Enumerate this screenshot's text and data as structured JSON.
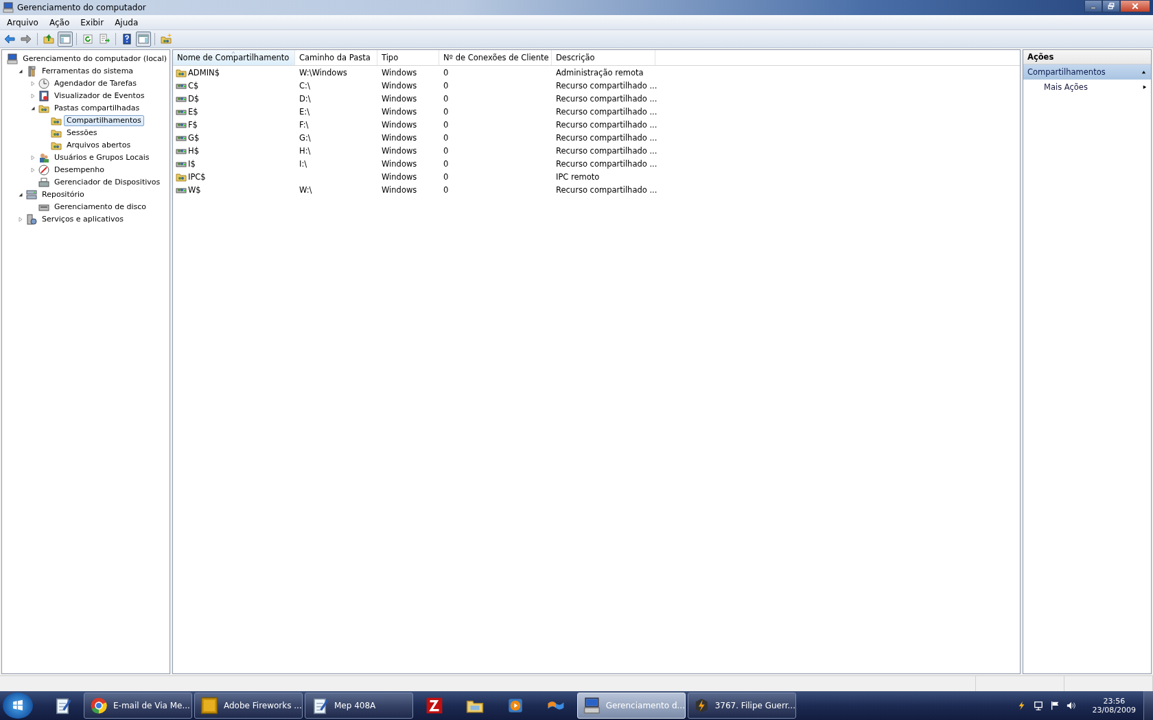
{
  "window": {
    "title": "Gerenciamento do computador"
  },
  "menu": [
    {
      "label": "Arquivo"
    },
    {
      "label": "Ação"
    },
    {
      "label": "Exibir"
    },
    {
      "label": "Ajuda"
    }
  ],
  "toolbar": [
    {
      "buttons": [
        {
          "kind": "back",
          "pressed": false
        },
        {
          "kind": "forward",
          "pressed": false
        }
      ]
    },
    {
      "buttons": [
        {
          "kind": "up",
          "pressed": false
        },
        {
          "kind": "tree",
          "pressed": true
        }
      ]
    },
    {
      "buttons": [
        {
          "kind": "refresh",
          "pressed": false
        },
        {
          "kind": "export",
          "pressed": false
        }
      ]
    },
    {
      "buttons": [
        {
          "kind": "help",
          "pressed": false
        },
        {
          "kind": "pane",
          "pressed": true
        }
      ]
    },
    {
      "buttons": [
        {
          "kind": "newshare",
          "pressed": false
        }
      ]
    }
  ],
  "tree": [
    {
      "label": "Gerenciamento do computador (local)",
      "kind": "computer",
      "selected": false,
      "children": [
        {
          "label": "Ferramentas do sistema",
          "kind": "tools",
          "expanded": true,
          "selected": false,
          "children": [
            {
              "label": "Agendador de Tarefas",
              "kind": "clock",
              "expanded": false,
              "selected": false
            },
            {
              "label": "Visualizador de Eventos",
              "kind": "event",
              "expanded": false,
              "selected": false
            },
            {
              "label": "Pastas compartilhadas",
              "kind": "share",
              "expanded": true,
              "selected": false,
              "children": [
                {
                  "label": "Compartilhamentos",
                  "kind": "share",
                  "selected": true
                },
                {
                  "label": "Sessões",
                  "kind": "share",
                  "selected": false
                },
                {
                  "label": "Arquivos abertos",
                  "kind": "share",
                  "selected": false
                }
              ]
            },
            {
              "label": "Usuários e Grupos Locais",
              "kind": "users",
              "expanded": false,
              "selected": false
            },
            {
              "label": "Desempenho",
              "kind": "perf",
              "expanded": false,
              "selected": false
            },
            {
              "label": "Gerenciador de Dispositivos",
              "kind": "device",
              "selected": false
            }
          ]
        },
        {
          "label": "Repositório",
          "kind": "storage",
          "expanded": true,
          "selected": false,
          "children": [
            {
              "label": "Gerenciamento de disco",
              "kind": "disk",
              "selected": false
            }
          ]
        },
        {
          "label": "Serviços e aplicativos",
          "kind": "services",
          "expanded": false,
          "selected": false
        }
      ]
    }
  ],
  "table": {
    "columns": [
      {
        "label": "Nome de Compartilhamento",
        "sorted": true
      },
      {
        "label": "Caminho da Pasta",
        "sorted": false
      },
      {
        "label": "Tipo",
        "sorted": false
      },
      {
        "label": "Nº de Conexões de Cliente",
        "sorted": false
      },
      {
        "label": "Descrição",
        "sorted": false
      }
    ],
    "rows": [
      {
        "kind": "folder",
        "cells": [
          "ADMIN$",
          "W:\\Windows",
          "Windows",
          "0",
          "Administração remota"
        ]
      },
      {
        "kind": "drive",
        "cells": [
          "C$",
          "C:\\",
          "Windows",
          "0",
          "Recurso compartilhado ..."
        ]
      },
      {
        "kind": "drive",
        "cells": [
          "D$",
          "D:\\",
          "Windows",
          "0",
          "Recurso compartilhado ..."
        ]
      },
      {
        "kind": "drive",
        "cells": [
          "E$",
          "E:\\",
          "Windows",
          "0",
          "Recurso compartilhado ..."
        ]
      },
      {
        "kind": "drive",
        "cells": [
          "F$",
          "F:\\",
          "Windows",
          "0",
          "Recurso compartilhado ..."
        ]
      },
      {
        "kind": "drive",
        "cells": [
          "G$",
          "G:\\",
          "Windows",
          "0",
          "Recurso compartilhado ..."
        ]
      },
      {
        "kind": "drive",
        "cells": [
          "H$",
          "H:\\",
          "Windows",
          "0",
          "Recurso compartilhado ..."
        ]
      },
      {
        "kind": "drive",
        "cells": [
          "I$",
          "I:\\",
          "Windows",
          "0",
          "Recurso compartilhado ..."
        ]
      },
      {
        "kind": "folder",
        "cells": [
          "IPC$",
          "",
          "Windows",
          "0",
          "IPC remoto"
        ]
      },
      {
        "kind": "drive",
        "cells": [
          "W$",
          "W:\\",
          "Windows",
          "0",
          "Recurso compartilhado ..."
        ]
      }
    ]
  },
  "actions": {
    "title": "Ações",
    "sections": [
      {
        "label": "Compartilhamentos",
        "expanded": true,
        "items": [
          {
            "label": "Mais Ações"
          }
        ]
      }
    ]
  },
  "taskbar": {
    "items": [
      {
        "kind": "notepad",
        "active": false
      },
      {
        "kind": "chrome",
        "label": "E-mail de Via Me...",
        "active": false
      },
      {
        "kind": "fireworks",
        "label": "Adobe Fireworks ...",
        "active": false
      },
      {
        "kind": "notepad",
        "label": "Mep 408A",
        "active": false
      },
      {
        "kind": "filezilla",
        "active": false
      },
      {
        "kind": "explorer",
        "active": false
      },
      {
        "kind": "media",
        "active": false
      },
      {
        "kind": "windows",
        "active": false
      },
      {
        "kind": "computer",
        "label": "Gerenciamento d...",
        "active": true
      },
      {
        "kind": "winamp",
        "label": "3767. Filipe Guerr...",
        "active": false
      }
    ],
    "time": "23:56",
    "date": "23/08/2009"
  }
}
